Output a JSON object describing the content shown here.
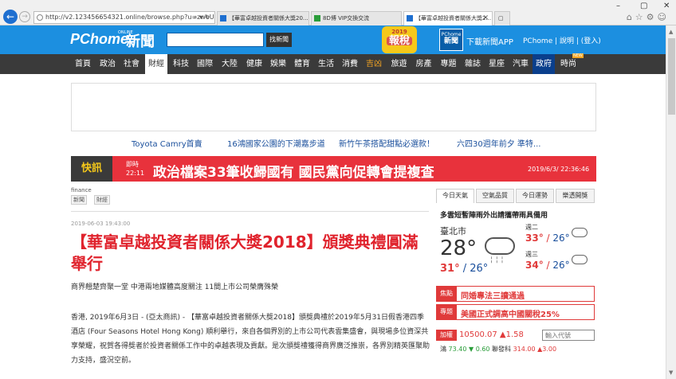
{
  "browser": {
    "url": "http://v2.123456654321.online/browse.php?u=zweUp/ws",
    "tools": "⌕ ▾ ↻",
    "tabs": [
      {
        "label": "【華富卓越投資者關係大獎20..."
      },
      {
        "label": "8D博 VIP交換交流"
      },
      {
        "label": "【華富卓越投資者關係大獎2..."
      }
    ],
    "window_controls": [
      "–",
      "▢",
      "✕"
    ],
    "toolbar_icons": "⌂☆⚙☺"
  },
  "header": {
    "logo": "PChome",
    "logo_sub": "ONLINE",
    "logo_news": "新聞",
    "search_placeholder": "",
    "search_button": "找新聞",
    "tax_badge_year": "2019",
    "tax_badge_text": "報稅",
    "app_icon_top": "PChome",
    "app_icon_bottom": "新聞",
    "app_text": "下載新聞APP",
    "user_links": "PChome | 說明 | (登入)"
  },
  "nav": {
    "items": [
      "首頁",
      "政治",
      "社會",
      "財經",
      "科技",
      "國際",
      "大陸",
      "健康",
      "娛樂",
      "體育",
      "生活",
      "消費",
      "吉凶",
      "旅遊",
      "房產",
      "專題",
      "雜誌",
      "星座",
      "汽車",
      "政府",
      "時尚"
    ],
    "new_badge": "NEW"
  },
  "ads": {
    "links": [
      "Toyota Camry首賣",
      "16鴻國家公園的下潮嘉步道",
      "新竹午茶搭配甜點必選款！",
      "六四30週年前夕 準特..."
    ]
  },
  "flash": {
    "label": "快訊",
    "time_label": "即時",
    "time": "22:11",
    "text": "政治檔案33筆收歸國有 國民黨向促轉會提複查",
    "date": "2019/6/3/ 22:36:46"
  },
  "article": {
    "category": "finance",
    "tags": [
      "新聞",
      "財經"
    ],
    "date": "2019-06-03 19:43:00",
    "title": "【華富卓越投資者關係大獎2018】頒獎典禮圓滿舉行",
    "subtitle": "商界翹楚齊聚一堂 中港兩地媒體高度關注 11間上市公司榮膺殊榮",
    "body": "香港, 2019年6月3日 - (亞太商訊) - 【華富卓越投資者關係大獎2018】頒獎典禮於2019年5月31日假香港四季酒店 (Four Seasons Hotel Hong Kong) 順利舉行，來自各個界別的上市公司代表雲集盛會，與現場多位資深共享榮耀，祝賀各得獎者於投資者關係工作中的卓越表現及貢獻。是次頒獎禮獲得商界廣泛推崇，各界別精英匯聚助力支持，盛況空前。"
  },
  "sidebar": {
    "tabs": [
      "今日天氣",
      "空氣品質",
      "今日運勢",
      "樂透開獎"
    ],
    "weather": {
      "headline": "多雲短暫陣雨外出請攜帶雨具備用",
      "city": "臺北市",
      "temp": "28°",
      "range_hi": "31°",
      "range_sep": " / ",
      "range_lo": "26°",
      "days": [
        {
          "name": "週二",
          "hi": "33°",
          "lo": "26°"
        },
        {
          "name": "週三",
          "hi": "34°",
          "lo": "26°"
        }
      ]
    },
    "focus": [
      {
        "label": "焦點",
        "text": "同婚專法三讀通過"
      },
      {
        "label": "專題",
        "text": "美國正式調高中國關稅25%"
      }
    ],
    "stock": {
      "label": "加權",
      "value": "10500.07 ▲1.58",
      "input_placeholder": "輸入代號",
      "line_a": "鴻",
      "line_a_val": "73.40 ▼ 0.60",
      "line_b": "聯發科",
      "line_b_val": "314.00 ▲3.00"
    }
  },
  "colors": {
    "header_blue": "#1c8fe0",
    "nav_dark": "#3a3a3a",
    "flash_red": "#e8323c",
    "title_red": "#e0232d"
  }
}
